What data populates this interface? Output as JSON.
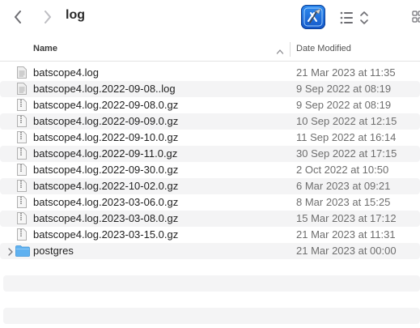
{
  "toolbar": {
    "title": "log",
    "back_icon": "chevron-left-icon",
    "forward_icon": "chevron-right-icon",
    "app_icon": "xcode-icon",
    "view_icon": "list-view-icon",
    "group_icon": "group-icon"
  },
  "columns": {
    "name": "Name",
    "date_modified": "Date Modified",
    "sort_icon": "chevron-up-icon"
  },
  "files": [
    {
      "name": "batscope4.log",
      "date": "21 Mar 2023 at 11:35",
      "icon": "text-file-icon"
    },
    {
      "name": "batscope4.log.2022-09-08..log",
      "date": "9 Sep 2022 at 08:19",
      "icon": "text-file-icon"
    },
    {
      "name": "batscope4.log.2022-09-08.0.gz",
      "date": "9 Sep 2022 at 08:19",
      "icon": "archive-file-icon"
    },
    {
      "name": "batscope4.log.2022-09-09.0.gz",
      "date": "10 Sep 2022 at 12:15",
      "icon": "archive-file-icon"
    },
    {
      "name": "batscope4.log.2022-09-10.0.gz",
      "date": "11 Sep 2022 at 16:14",
      "icon": "archive-file-icon"
    },
    {
      "name": "batscope4.log.2022-09-11.0.gz",
      "date": "30 Sep 2022 at 17:15",
      "icon": "archive-file-icon"
    },
    {
      "name": "batscope4.log.2022-09-30.0.gz",
      "date": "2 Oct 2022 at 10:50",
      "icon": "archive-file-icon"
    },
    {
      "name": "batscope4.log.2022-10-02.0.gz",
      "date": "6 Mar 2023 at 09:21",
      "icon": "archive-file-icon"
    },
    {
      "name": "batscope4.log.2023-03-06.0.gz",
      "date": "8 Mar 2023 at 15:25",
      "icon": "archive-file-icon"
    },
    {
      "name": "batscope4.log.2023-03-08.0.gz",
      "date": "15 Mar 2023 at 17:12",
      "icon": "archive-file-icon"
    },
    {
      "name": "batscope4.log.2023-03-15.0.gz",
      "date": "21 Mar 2023 at 11:31",
      "icon": "archive-file-icon"
    },
    {
      "name": "postgres",
      "date": "21 Mar 2023 at 00:00",
      "icon": "folder-icon",
      "disclosure": "disclosure-triangle-icon"
    }
  ],
  "colors": {
    "folder": "#5fb1f0",
    "stripe": "#f4f4f5",
    "app_icon": "#1f6fe0"
  }
}
